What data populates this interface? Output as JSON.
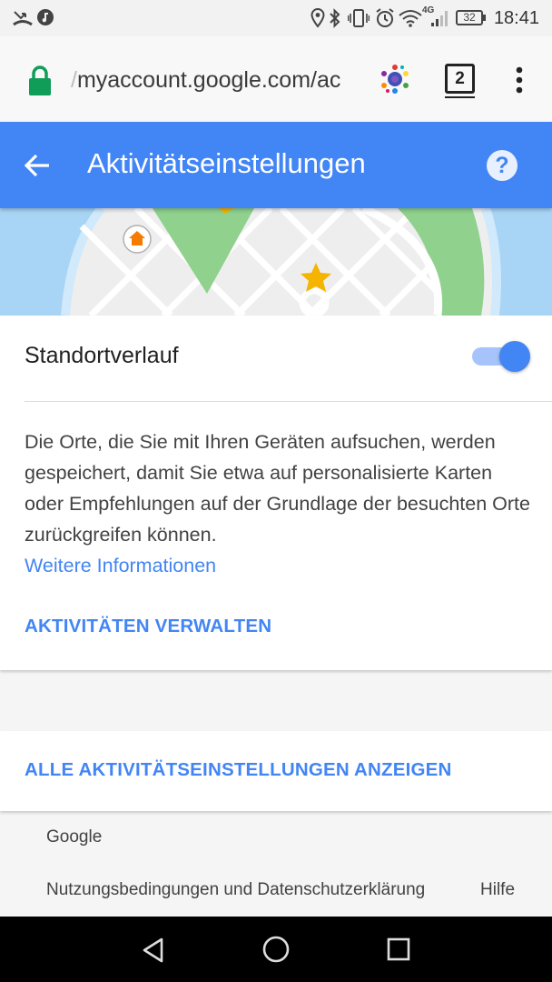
{
  "status_bar": {
    "time": "18:41",
    "battery": "32",
    "network": "4G"
  },
  "browser": {
    "url_prefix": "/",
    "url": "myaccount.google.com/ac",
    "tab_count": "2"
  },
  "app_bar": {
    "title": "Aktivitätseinstellungen",
    "help_glyph": "?"
  },
  "setting": {
    "label": "Standortverlauf",
    "enabled": true,
    "description": "Die Orte, die Sie mit Ihren Geräten aufsuchen, werden gespeichert, damit Sie etwa auf personalisierte Karten oder Empfehlungen auf der Grundlage der besuchten Orte zurückgreifen können.",
    "more_info_link": "Weitere Informationen",
    "manage_button": "AKTIVITÄTEN VERWALTEN"
  },
  "all_settings_button": "ALLE AKTIVITÄTSEINSTELLUNGEN ANZEIGEN",
  "footer": {
    "brand": "Google",
    "terms_link": "Nutzungsbedingungen und Datenschutzerklärung",
    "help_link": "Hilfe"
  },
  "colors": {
    "accent": "#4285f4",
    "toggle_track": "#a6c4fb",
    "map_green": "#8fd18d",
    "map_water": "#a8d4f5",
    "star": "#f4b400",
    "home_icon": "#f57c00"
  }
}
